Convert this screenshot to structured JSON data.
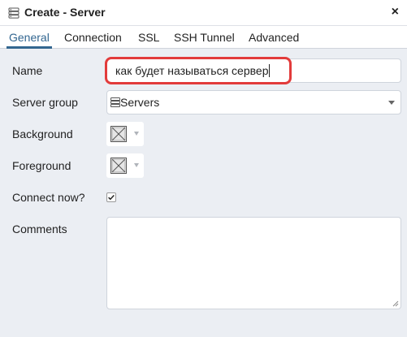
{
  "window": {
    "title": "Create - Server",
    "title_icon": "server-icon",
    "close_symbol": "×"
  },
  "tabs": [
    {
      "label": "General",
      "active": true
    },
    {
      "label": "Connection",
      "active": false
    },
    {
      "label": "SSL",
      "active": false
    },
    {
      "label": "SSH Tunnel",
      "active": false
    },
    {
      "label": "Advanced",
      "active": false
    }
  ],
  "form": {
    "name": {
      "label": "Name",
      "value": "как будет называться сервер"
    },
    "server_group": {
      "label": "Server group",
      "value": "Servers",
      "icon": "servers-icon"
    },
    "background": {
      "label": "Background",
      "swatch": "no-color-swatch-icon"
    },
    "foreground": {
      "label": "Foreground",
      "swatch": "no-color-swatch-icon"
    },
    "connect_now": {
      "label": "Connect now?",
      "checked": true
    },
    "comments": {
      "label": "Comments",
      "value": ""
    }
  },
  "colors": {
    "accent": "#326690",
    "highlight": "#e23b3b",
    "background": "#ebeef3"
  }
}
